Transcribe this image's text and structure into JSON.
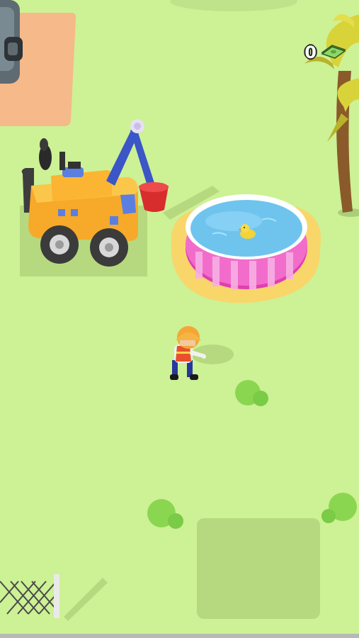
{
  "hud": {
    "money_value": "0",
    "money_icon": "cash-icon"
  },
  "colors": {
    "grass": "#cdf195",
    "vehicle_body": "#f7b62c",
    "pool_rim": "#e03fb0",
    "water": "#6fc4ee",
    "sand": "#f8d66a"
  }
}
